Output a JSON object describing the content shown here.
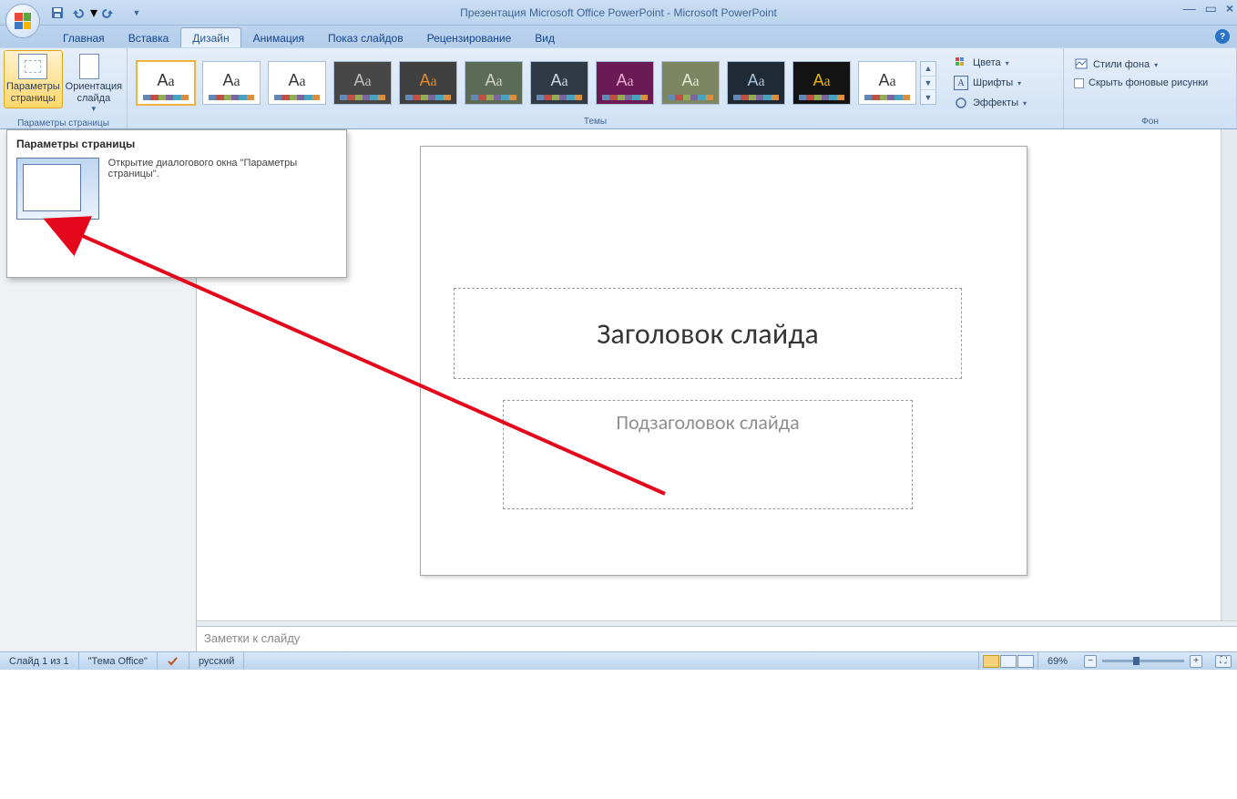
{
  "title": {
    "doc": "Презентация Microsoft Office PowerPoint",
    "app": "Microsoft PowerPoint"
  },
  "tabs": {
    "home": "Главная",
    "insert": "Вставка",
    "design": "Дизайн",
    "animation": "Анимация",
    "slideshow": "Показ слайдов",
    "review": "Рецензирование",
    "view": "Вид"
  },
  "ribbon": {
    "pageSetup": {
      "params": "Параметры\nстраницы",
      "orient": "Ориентация\nслайда",
      "group": "Параметры страницы"
    },
    "themes": {
      "group": "Темы",
      "colors": "Цвета",
      "fonts": "Шрифты",
      "effects": "Эффекты"
    },
    "background": {
      "group": "Фон",
      "styles": "Стили фона",
      "hide": "Скрыть фоновые рисунки"
    }
  },
  "tooltip": {
    "title": "Параметры страницы",
    "text": "Открытие диалогового окна \"Параметры страницы\"."
  },
  "slide": {
    "title": "Заголовок слайда",
    "subtitle": "Подзаголовок слайда"
  },
  "notes": "Заметки к слайду",
  "status": {
    "slide": "Слайд 1 из 1",
    "theme": "\"Тема Office\"",
    "lang": "русский",
    "zoom": "69%"
  },
  "themeThumbs": [
    {
      "bg": "#ffffff",
      "fg": "#303030",
      "sel": true
    },
    {
      "bg": "#ffffff",
      "fg": "#3a3a3a"
    },
    {
      "bg": "#ffffff",
      "fg": "#3a3a3a"
    },
    {
      "bg": "#474747",
      "fg": "#bfbfbf"
    },
    {
      "bg": "#404040",
      "fg": "#e28a2b"
    },
    {
      "bg": "#5c6b56",
      "fg": "#d2d2c4"
    },
    {
      "bg": "#2f3a44",
      "fg": "#cfd6de"
    },
    {
      "bg": "#6a1b55",
      "fg": "#e9a9d0"
    },
    {
      "bg": "#7c8663",
      "fg": "#e6ead3"
    },
    {
      "bg": "#1f2a36",
      "fg": "#a6c3db"
    },
    {
      "bg": "#131313",
      "fg": "#e8b500"
    },
    {
      "bg": "#ffffff",
      "fg": "#3a3a3a"
    }
  ]
}
